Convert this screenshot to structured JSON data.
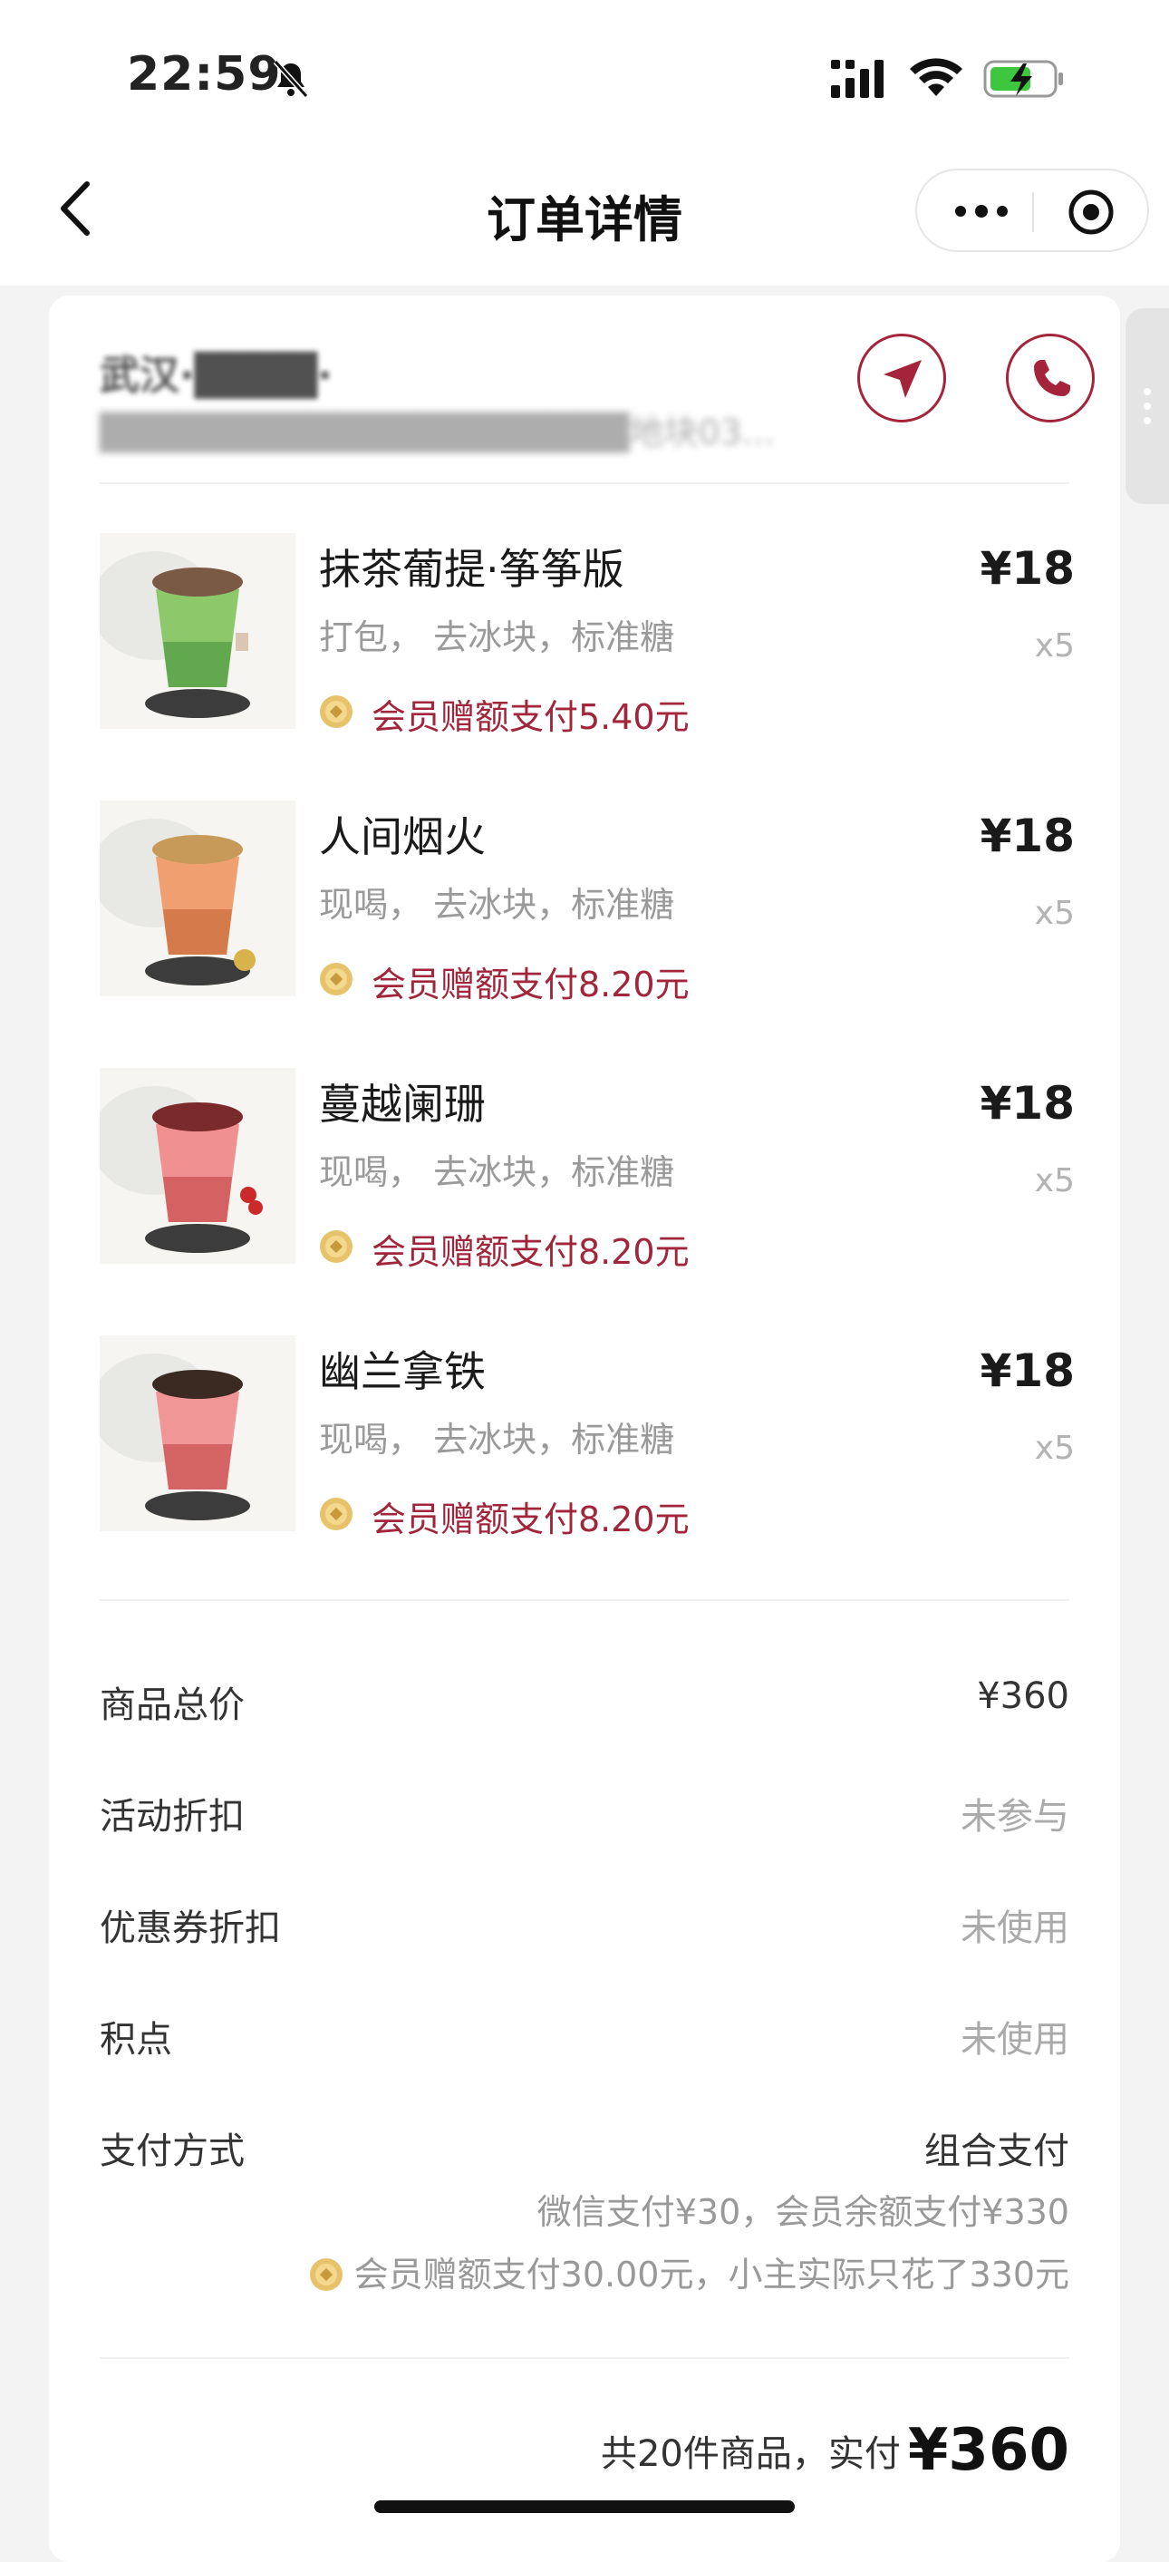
{
  "status_bar": {
    "time": "22:59"
  },
  "nav": {
    "title": "订单详情"
  },
  "store": {
    "name": "武汉·████·",
    "address": "████████████████████地块03..."
  },
  "items": [
    {
      "name": "抹茶葡提·筝筝版",
      "spec": "打包， 去冰块，标准糖",
      "promo": "会员赠额支付5.40元",
      "price": "¥18",
      "qty": "x5",
      "cup_color": "#8dc86a",
      "cup_color2": "#4f9a43",
      "topping": "#7a5a45"
    },
    {
      "name": "人间烟火",
      "spec": "现喝， 去冰块，标准糖",
      "promo": "会员赠额支付8.20元",
      "price": "¥18",
      "qty": "x5",
      "cup_color": "#f0a070",
      "cup_color2": "#c96a3a",
      "topping": "#c89a5a"
    },
    {
      "name": "蔓越阑珊",
      "spec": "现喝， 去冰块，标准糖",
      "promo": "会员赠额支付8.20元",
      "price": "¥18",
      "qty": "x5",
      "cup_color": "#f09090",
      "cup_color2": "#c94f4f",
      "topping": "#7a2a2a"
    },
    {
      "name": "幽兰拿铁",
      "spec": "现喝， 去冰块，标准糖",
      "promo": "会员赠额支付8.20元",
      "price": "¥18",
      "qty": "x5",
      "cup_color": "#f09696",
      "cup_color2": "#c95050",
      "topping": "#3a2a22"
    }
  ],
  "summary": {
    "goods_total_label": "商品总价",
    "goods_total_value": "¥360",
    "activity_label": "活动折扣",
    "activity_value": "未参与",
    "coupon_label": "优惠券折扣",
    "coupon_value": "未使用",
    "points_label": "积点",
    "points_value": "未使用",
    "payment_label": "支付方式",
    "payment_value": "组合支付",
    "payment_detail": "微信支付¥30，会员余额支付¥330",
    "payment_promo": "会员赠额支付30.00元，小主实际只花了330元"
  },
  "total": {
    "label": "共20件商品，实付",
    "amount": "¥360"
  },
  "colors": {
    "accent": "#a3243b",
    "promo": "#a1263c"
  },
  "icons": [
    "bell-slash-icon",
    "signal-icon",
    "wifi-icon",
    "battery-charging-icon",
    "back-chevron-icon",
    "more-icon",
    "target-icon",
    "navigate-icon",
    "phone-icon",
    "coin-icon"
  ]
}
